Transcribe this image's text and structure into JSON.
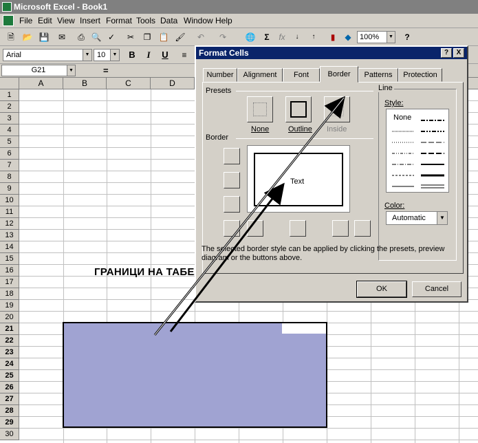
{
  "app": {
    "title": "Microsoft Excel - Book1"
  },
  "menu": [
    "File",
    "Edit",
    "View",
    "Insert",
    "Format",
    "Tools",
    "Data",
    "Window",
    "Help"
  ],
  "toolbar": {
    "zoom": "100%"
  },
  "format_bar": {
    "font": "Arial",
    "size": "10",
    "bold": "B",
    "italic": "I",
    "underline": "U"
  },
  "formula_bar": {
    "cell_ref": "G21",
    "equals": "="
  },
  "grid": {
    "columns": [
      "A",
      "B",
      "C",
      "D"
    ],
    "rows": [
      "1",
      "2",
      "3",
      "4",
      "5",
      "6",
      "7",
      "8",
      "9",
      "10",
      "11",
      "12",
      "13",
      "14",
      "15",
      "16",
      "17",
      "18",
      "19",
      "20",
      "21",
      "22",
      "23",
      "24",
      "25",
      "26",
      "27",
      "28",
      "29",
      "30"
    ],
    "selection_text": "ГРАНИЦИ НА ТАБЕЛАТА"
  },
  "dialog": {
    "title": "Format Cells",
    "help_btn": "?",
    "close_btn": "X",
    "tabs": [
      "Number",
      "Alignment",
      "Font",
      "Border",
      "Patterns",
      "Protection"
    ],
    "active_tab": "Border",
    "presets_label": "Presets",
    "presets": [
      "None",
      "Outline",
      "Inside"
    ],
    "border_label": "Border",
    "preview_text": "Text",
    "line_label": "Line",
    "style_label": "Style:",
    "style_none": "None",
    "color_label": "Color:",
    "color_value": "Automatic",
    "hint": "The selected border style can be applied by clicking the presets, preview diagram or the buttons above.",
    "ok": "OK",
    "cancel": "Cancel"
  }
}
